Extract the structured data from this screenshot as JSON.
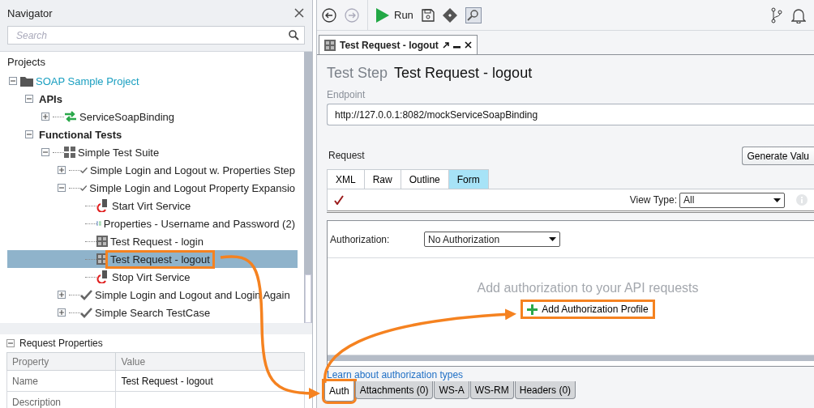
{
  "navigator": {
    "title": "Navigator",
    "search": {
      "placeholder": "Search"
    },
    "tree": {
      "root_label": "Projects",
      "items": [
        {
          "label": "SOAP Sample Project",
          "kind": "project",
          "expanded": true,
          "selected": false,
          "highlighted": false,
          "children": [
            {
              "label": "APIs",
              "kind": "group",
              "expanded": true,
              "selected": false,
              "highlighted": false,
              "children": [
                {
                  "label": "ServiceSoapBinding",
                  "kind": "api",
                  "expanded": false,
                  "selected": false,
                  "highlighted": false
                }
              ]
            },
            {
              "label": "Functional Tests",
              "kind": "group",
              "expanded": true,
              "selected": false,
              "highlighted": false,
              "children": [
                {
                  "label": "Simple Test Suite",
                  "kind": "suite",
                  "expanded": true,
                  "selected": false,
                  "highlighted": false,
                  "children": [
                    {
                      "label": "Simple Login and Logout w. Properties Step",
                      "kind": "testcase",
                      "expanded": false,
                      "selected": false,
                      "highlighted": false
                    },
                    {
                      "label": "Simple Login and Logout Property Expansio",
                      "kind": "testcase",
                      "expanded": true,
                      "selected": false,
                      "highlighted": false,
                      "children": [
                        {
                          "label": "Start Virt Service",
                          "kind": "virt",
                          "selected": false,
                          "highlighted": false
                        },
                        {
                          "label": "Properties - Username and Password (2)",
                          "kind": "properties",
                          "selected": false,
                          "highlighted": false
                        },
                        {
                          "label": "Test Request - login",
                          "kind": "soap",
                          "selected": false,
                          "highlighted": false
                        },
                        {
                          "label": "Test Request - logout",
                          "kind": "soap",
                          "selected": true,
                          "highlighted": true
                        },
                        {
                          "label": "Stop Virt Service",
                          "kind": "virt",
                          "selected": false,
                          "highlighted": false
                        }
                      ]
                    },
                    {
                      "label": "Simple Login and Logout and Login Again",
                      "kind": "testcase",
                      "expanded": false,
                      "selected": false,
                      "highlighted": false
                    },
                    {
                      "label": "Simple Search TestCase",
                      "kind": "testcase",
                      "expanded": false,
                      "selected": false,
                      "highlighted": false
                    }
                  ]
                }
              ]
            }
          ]
        }
      ]
    }
  },
  "properties_panel": {
    "title": "Request Properties",
    "expanded": true,
    "columns": [
      "Property",
      "Value"
    ],
    "rows": [
      [
        "Name",
        "Test Request - logout"
      ],
      [
        "Description",
        ""
      ]
    ]
  },
  "toolbar": {
    "run_label": "Run"
  },
  "editor_tab": {
    "title": "Test Request - logout"
  },
  "step": {
    "type_label": "Test Step",
    "name": "Test Request - logout",
    "endpoint_label": "Endpoint",
    "endpoint": "http://127.0.0.1:8082/mockServiceSoapBinding"
  },
  "request": {
    "label": "Request",
    "generate_button": "Generate Valu",
    "tabs": [
      {
        "label": "XML",
        "selected": false
      },
      {
        "label": "Raw",
        "selected": false
      },
      {
        "label": "Outline",
        "selected": false
      },
      {
        "label": "Form",
        "selected": true
      }
    ],
    "view_type_label": "View Type:",
    "view_type": "All"
  },
  "auth": {
    "label": "Authorization:",
    "value": "No Authorization",
    "empty_message": "Add authorization to your API requests",
    "add_button": {
      "label": "Add Authorization Profile",
      "highlighted": true
    },
    "learn_link": "Learn about authorization types"
  },
  "bottom_tabs": [
    {
      "label": "Auth",
      "selected": true,
      "highlighted": true
    },
    {
      "label": "Attachments (0)",
      "selected": false,
      "highlighted": false
    },
    {
      "label": "WS-A",
      "selected": false,
      "highlighted": false
    },
    {
      "label": "WS-RM",
      "selected": false,
      "highlighted": false
    },
    {
      "label": "Headers (0)",
      "selected": false,
      "highlighted": false
    }
  ]
}
